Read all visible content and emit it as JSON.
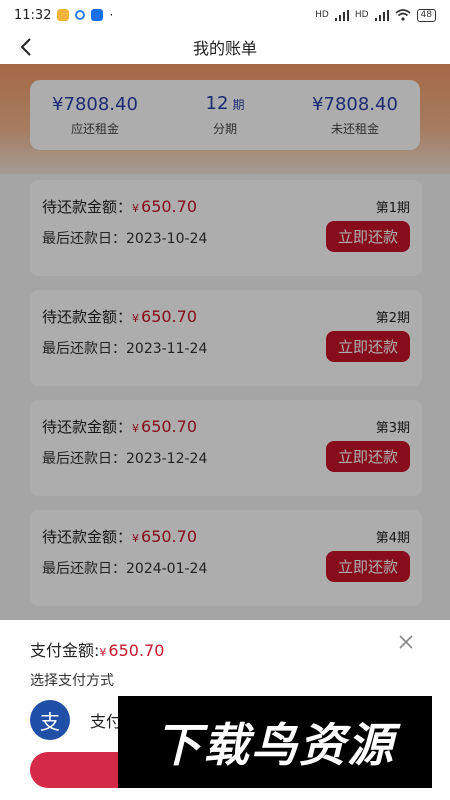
{
  "status_bar": {
    "time": "11:32",
    "signal_1": "HD",
    "signal_2": "HD",
    "battery": "48"
  },
  "nav": {
    "title": "我的账单"
  },
  "summary": {
    "due_rent_value": "¥7808.40",
    "due_rent_label": "应还租金",
    "installments_value": "12",
    "installments_unit": "期",
    "installments_label": "分期",
    "unpaid_rent_value": "¥7808.40",
    "unpaid_rent_label": "未还租金"
  },
  "bills": [
    {
      "amount_label": "待还款金额：",
      "currency": "¥",
      "amount": "650.70",
      "date_label": "最后还款日：",
      "date": "2023-10-24",
      "period": "第1期",
      "button": "立即还款"
    },
    {
      "amount_label": "待还款金额：",
      "currency": "¥",
      "amount": "650.70",
      "date_label": "最后还款日：",
      "date": "2023-11-24",
      "period": "第2期",
      "button": "立即还款"
    },
    {
      "amount_label": "待还款金额：",
      "currency": "¥",
      "amount": "650.70",
      "date_label": "最后还款日：",
      "date": "2023-12-24",
      "period": "第3期",
      "button": "立即还款"
    },
    {
      "amount_label": "待还款金额：",
      "currency": "¥",
      "amount": "650.70",
      "date_label": "最后还款日：",
      "date": "2024-01-24",
      "period": "第4期",
      "button": "立即还款"
    }
  ],
  "sheet": {
    "amount_label": "支付金额:",
    "currency": "¥",
    "amount": "650.70",
    "subtitle": "选择支付方式",
    "method_icon_char": "支",
    "method_label": "支付"
  },
  "watermark": {
    "text": "下载鸟资源"
  },
  "colors": {
    "accent_red": "#c8142c",
    "summary_blue": "#2a3ea8",
    "alipay_blue": "#1f4fa6"
  }
}
